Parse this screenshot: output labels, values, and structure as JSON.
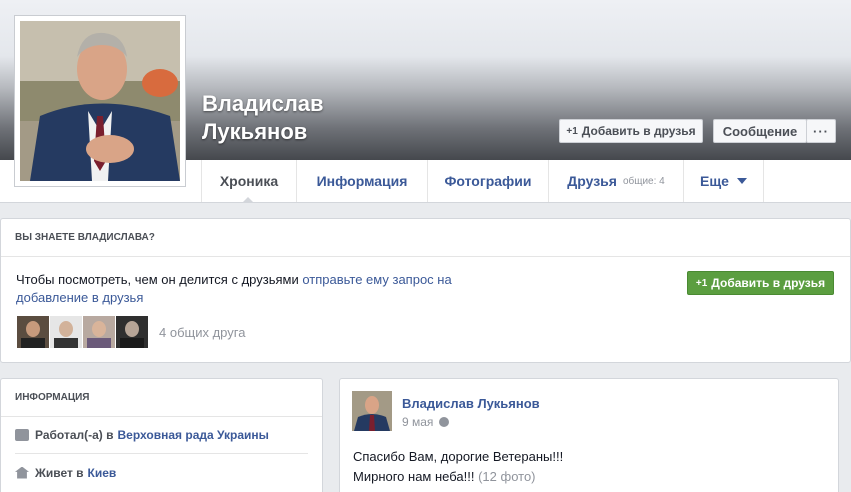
{
  "profile": {
    "name_line1": "Владислав",
    "name_line2": "Лукьянов"
  },
  "header_buttons": {
    "add_friend": "Добавить в друзья",
    "message": "Сообщение",
    "more": "···"
  },
  "tabs": [
    {
      "label": "Хроника",
      "active": true
    },
    {
      "label": "Информация"
    },
    {
      "label": "Фотографии"
    },
    {
      "label": "Друзья",
      "count": "общие: 4"
    },
    {
      "label": "Еще"
    }
  ],
  "know_panel": {
    "header": "ВЫ ЗНАЕТЕ ВЛАДИСЛАВА?",
    "text": "Чтобы посмотреть, чем он делится с друзьями",
    "link": "отправьте ему запрос на добавление в друзья",
    "button": "Добавить в друзья",
    "mutual": "4 общих друга"
  },
  "info_panel": {
    "header": "ИНФОРМАЦИЯ",
    "rows": [
      {
        "prefix": "Работал(-а) в",
        "link": "Верховная рада Украины",
        "icon": "briefcase-icon"
      },
      {
        "prefix": "Живет в",
        "link": "Киев",
        "icon": "home-icon"
      }
    ]
  },
  "post": {
    "author": "Владислав Лукьянов",
    "date": "9 мая",
    "line1": "Спасибо Вам, дорогие Ветераны!!!",
    "line2": "Мирного нам неба!!!",
    "photos": "(12 фото)"
  },
  "colors": {
    "link": "#3b5998",
    "green_button": "#5b9e40",
    "page_bg": "#e9ebee"
  }
}
